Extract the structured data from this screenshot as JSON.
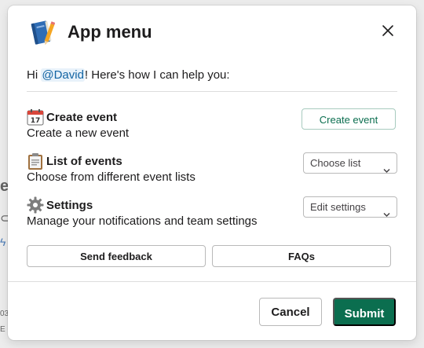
{
  "background": {
    "glyph1": "es",
    "glyph2": "⊂",
    "glyph3": "ϟ",
    "glyph4": "03",
    "glyph5": "E"
  },
  "modal": {
    "title": "App menu",
    "app_icon": "notebook-icon",
    "close_icon": "close-icon",
    "greeting_prefix": "Hi ",
    "greeting_mention": "@David",
    "greeting_suffix": "! Here's how I can help you:",
    "sections": [
      {
        "icon": "calendar-icon",
        "title": "Create event",
        "description": "Create a new event",
        "action": "Create event"
      },
      {
        "icon": "clipboard-icon",
        "title": "List of events",
        "description": "Choose from different event lists",
        "action": "Choose list"
      },
      {
        "icon": "gear-icon",
        "title": "Settings",
        "description": "Manage your notifications and team settings",
        "action": "Edit settings"
      }
    ],
    "feedback_label": "Send feedback",
    "faq_label": "FAQs",
    "cancel_label": "Cancel",
    "submit_label": "Submit"
  },
  "colors": {
    "accent": "#0b6e4f",
    "mention": "#1264a3",
    "border": "#b9b9b9"
  }
}
